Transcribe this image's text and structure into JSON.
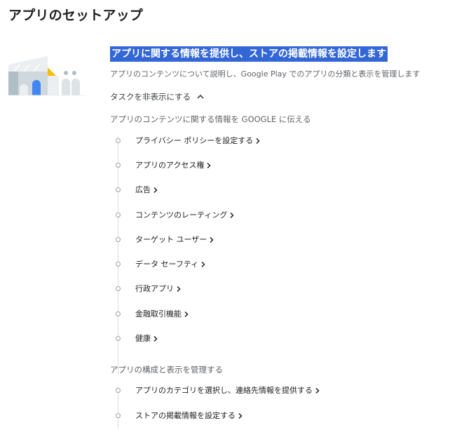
{
  "page": {
    "title": "アプリのセットアップ"
  },
  "section": {
    "heading": "アプリに関する情報を提供し、ストアの掲載情報を設定します",
    "description": "アプリのコンテンツについて説明し、Google Play でのアプリの分類と表示を管理します",
    "toggle_label": "タスクを非表示にする"
  },
  "groups": [
    {
      "title": "アプリのコンテンツに関する情報を GOOGLE に伝える",
      "tasks": [
        "プライバシー ポリシーを設定する",
        "アプリのアクセス権",
        "広告",
        "コンテンツのレーティング",
        "ターゲット ユーザー",
        "データ セーフティ",
        "行政アプリ",
        "金融取引機能",
        "健康"
      ]
    },
    {
      "title": "アプリの構成と表示を管理する",
      "tasks": [
        "アプリのカテゴリを選択し、連絡先情報を提供する",
        "ストアの掲載情報を設定する"
      ]
    }
  ],
  "colors": {
    "highlight": "#3367d6",
    "illustration_blue": "#4285f4",
    "illustration_yellow": "#fbbc04",
    "illustration_gray": "#cfd8dc"
  }
}
